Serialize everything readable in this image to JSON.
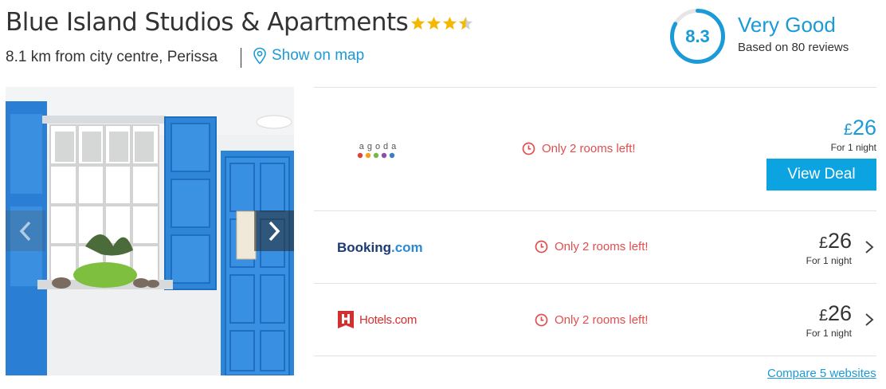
{
  "hotel": {
    "name": "Blue Island Studios & Apartments",
    "star_rating": 3.5,
    "distance_text": "8.1 km from city centre, Perissa",
    "map_link_label": "Show on map"
  },
  "rating": {
    "score": "8.3",
    "word": "Very Good",
    "reviews_text": "Based on 80 reviews",
    "accent": "#1a9ad6"
  },
  "gallery": {
    "prev_icon": "chevron-left-icon",
    "next_icon": "chevron-right-icon"
  },
  "deals": [
    {
      "provider_logo_text": "agoda",
      "availability": "Only 2 rooms left!",
      "currency": "£",
      "price": "26",
      "per_night": "For 1 night",
      "cta": "View Deal",
      "featured": true
    },
    {
      "provider_logo_text": "Booking.com",
      "provider_logo_parts": [
        "Booking",
        ".com"
      ],
      "availability": "Only 2 rooms left!",
      "currency": "£",
      "price": "26",
      "per_night": "For 1 night",
      "featured": false
    },
    {
      "provider_logo_text": "Hotels.com",
      "availability": "Only 2 rooms left!",
      "currency": "£",
      "price": "26",
      "per_night": "For 1 night",
      "featured": false
    }
  ],
  "compare_link": "Compare 5 websites",
  "colors": {
    "link_blue": "#1a9ad6",
    "cta_blue": "#0ba3e0",
    "urgency_red": "#e04e4e",
    "star_gold": "#f5b800"
  }
}
